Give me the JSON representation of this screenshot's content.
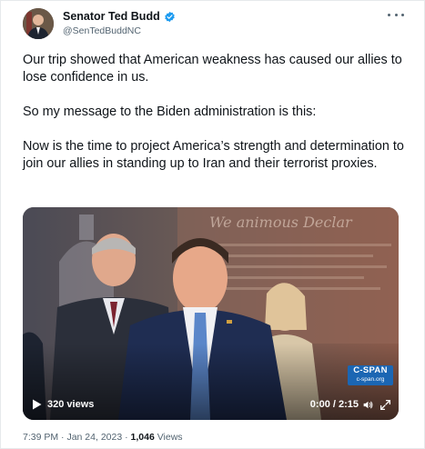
{
  "author": {
    "display_name": "Senator Ted Budd",
    "handle": "@SenTedBuddNC",
    "verified": true
  },
  "tweet": {
    "paragraphs": [
      "Our trip showed that American weakness has caused our allies to lose confidence in us.",
      "So my message to the Biden administration is this:",
      "Now is the time to project America’s strength and determination to join our allies in standing up to Iran and their terrorist proxies."
    ]
  },
  "video": {
    "views_label": "320 views",
    "time_label": "0:00 / 2:15",
    "watermark_logo": "C-SPAN",
    "watermark_url": "c-span.org",
    "icons": [
      "play-icon",
      "volume-icon",
      "expand-icon"
    ]
  },
  "meta": {
    "time": "7:39 PM",
    "separator1": " · ",
    "date": "Jan 24, 2023",
    "separator2": " · ",
    "views_count": "1,046",
    "views_word": " Views"
  },
  "colors": {
    "verified_blue": "#1d9bf0",
    "secondary_text": "#536471",
    "cspan_blue": "#1b66b3"
  }
}
